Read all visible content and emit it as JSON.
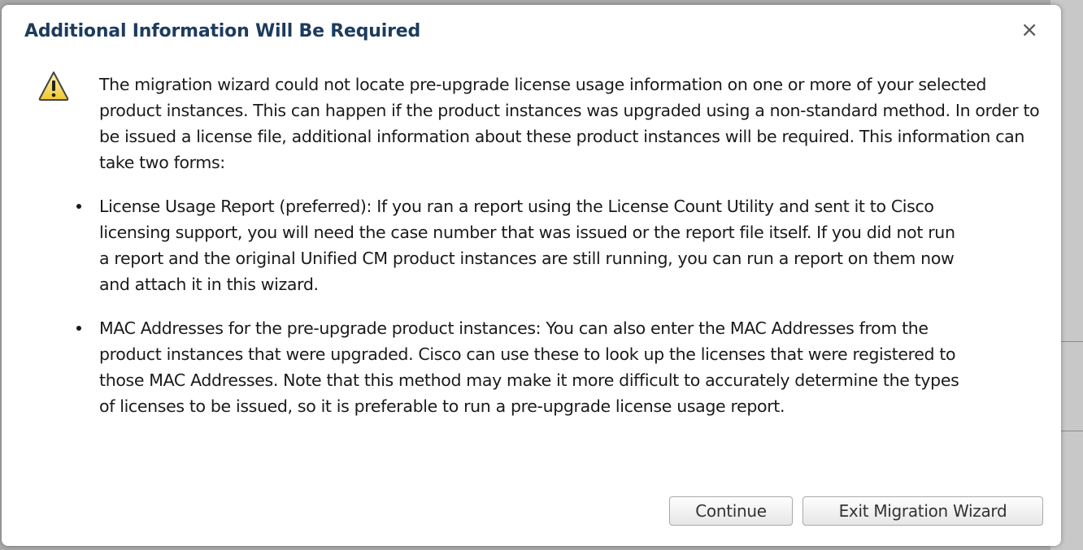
{
  "dialog": {
    "title": "Additional Information Will Be Required",
    "close_glyph": "×",
    "intro": "The migration wizard could not locate pre-upgrade license usage information on one or more of your selected product instances. This can happen if the product instances was upgraded using a non-standard method. In order to be issued a license file, additional information about these product instances will be required. This information can take two forms:",
    "bullets": [
      "License Usage Report (preferred): If you ran a report using the License Count Utility and sent it to Cisco licensing support, you will need the case number that was issued or the report file itself. If you did not run a report and the original Unified CM product instances are still running, you can run a report on them now and attach it in this wizard.",
      "MAC Addresses for the pre-upgrade product instances: You can also enter the MAC Addresses from the product instances that were upgraded. Cisco can use these to look up the licenses that were registered to those MAC Addresses. Note that this method may make it more difficult to accurately determine the types of licenses to be issued, so it is preferable to run a pre-upgrade license usage report."
    ],
    "buttons": {
      "continue_label": "Continue",
      "exit_label": "Exit Migration Wizard"
    },
    "icon": "warning-triangle-icon",
    "colors": {
      "title": "#1d3b5e",
      "warning_fill": "#f5d44a"
    }
  }
}
